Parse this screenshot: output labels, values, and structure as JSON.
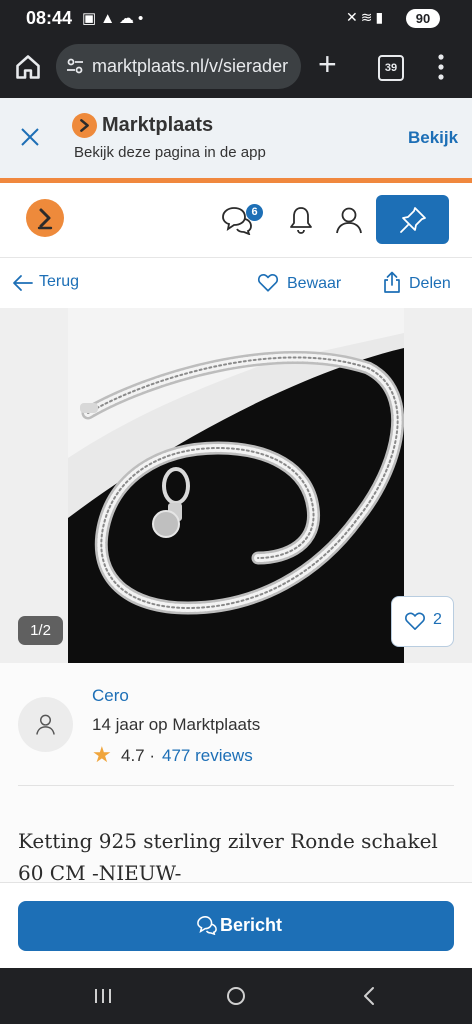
{
  "status_bar": {
    "time": "08:44",
    "battery": "90",
    "notification_icons": [
      "screenshot-icon",
      "alert-icon",
      "cloud-icon",
      "dot-icon"
    ],
    "system_icons": [
      "mute-icon",
      "wifi-icon",
      "signal-icon"
    ]
  },
  "browser": {
    "url": "marktplaats.nl/v/sierader",
    "tab_count": "39"
  },
  "app_banner": {
    "title": "Marktplaats",
    "subtitle": "Bekijk deze pagina in de app",
    "action": "Bekijk"
  },
  "header": {
    "messages_badge": "6"
  },
  "action_bar": {
    "back_label": "Terug",
    "save_label": "Bewaar",
    "share_label": "Delen"
  },
  "gallery": {
    "counter": "1/2",
    "favorites_count": "2"
  },
  "seller": {
    "name": "Cero",
    "years": "14 jaar op Marktplaats",
    "rating": "4.7",
    "separator": "·",
    "reviews": "477 reviews"
  },
  "listing": {
    "title": "Ketting 925 sterling zilver Ronde schakel 60 CM -NIEUW-"
  },
  "cta": {
    "label": "Bericht"
  },
  "colors": {
    "brand_blue": "#1d6fb6",
    "brand_orange": "#ee8a3b",
    "system_dark": "#202124"
  }
}
